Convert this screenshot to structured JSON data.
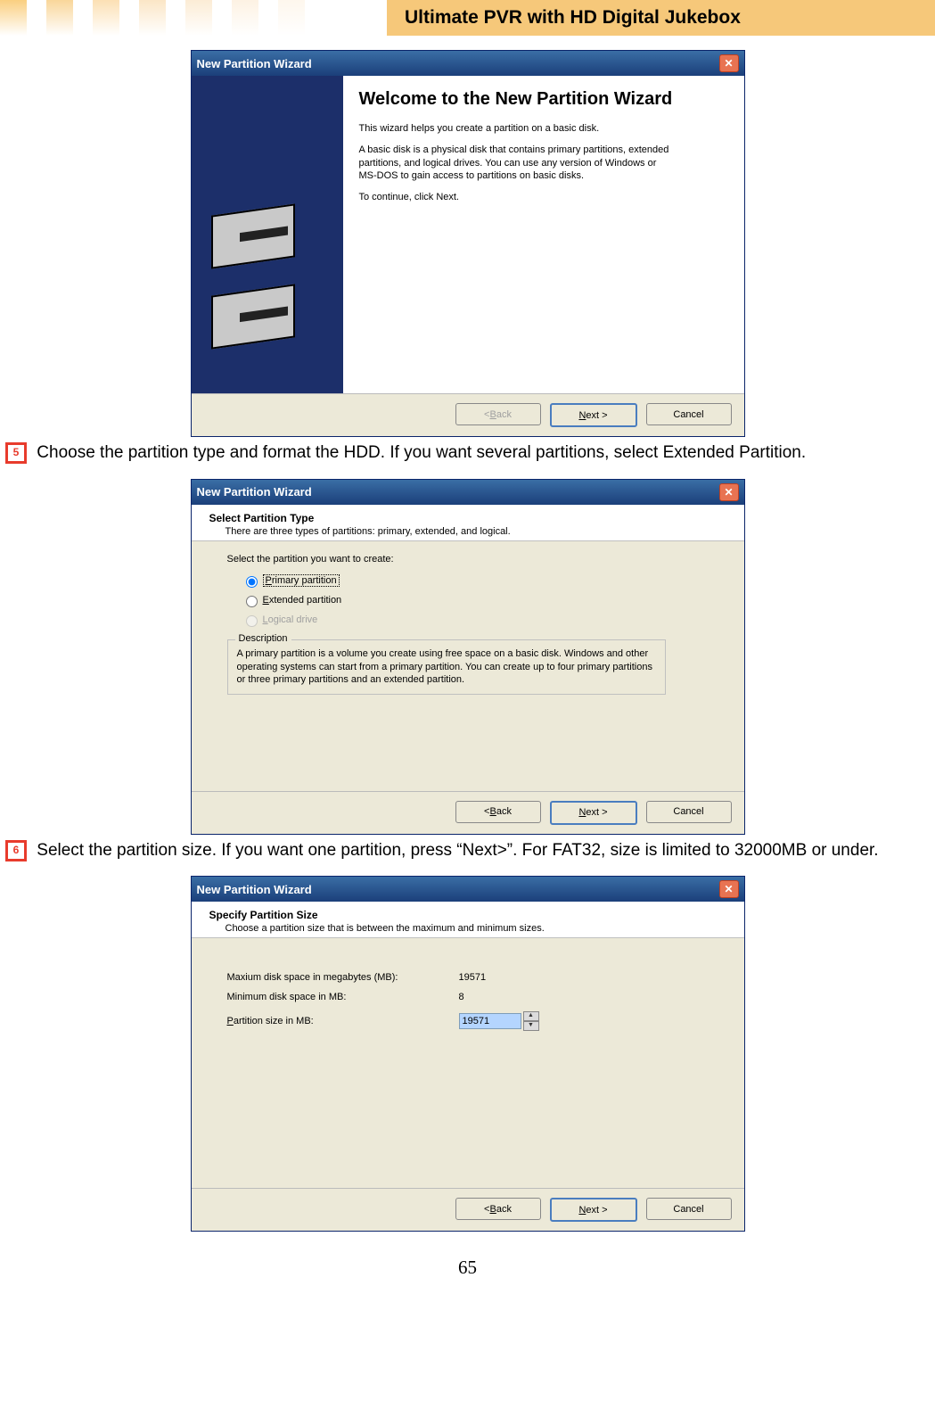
{
  "header": {
    "title": "Ultimate PVR with HD Digital Jukebox"
  },
  "steps": {
    "step5": {
      "num": "5",
      "text": "Choose the partition type and format the HDD. If you want several partitions, select Extended Partition."
    },
    "step6": {
      "num": "6",
      "text": "Select the partition size. If you want one partition, press “Next>”. For FAT32, size is limited to 32000MB or under."
    }
  },
  "dialog1": {
    "title": "New Partition Wizard",
    "heading": "Welcome to the New Partition Wizard",
    "p1": "This wizard helps you create a partition on a basic disk.",
    "p2": "A basic disk is a physical disk that contains primary partitions, extended partitions, and logical drives. You can use any version of Windows or MS-DOS to gain access to partitions on basic disks.",
    "p3": "To continue, click Next.",
    "buttons": {
      "back": "< Back",
      "next": "Next >",
      "cancel": "Cancel"
    }
  },
  "dialog2": {
    "title": "New Partition Wizard",
    "header": "Select Partition Type",
    "sub": "There are three types of partitions: primary, extended, and logical.",
    "prompt": "Select the partition you want to create:",
    "opt1": "Primary partition",
    "opt2": "Extended partition",
    "opt3": "Logical drive",
    "desc_legend": "Description",
    "desc": "A primary partition is a volume you create using free space on a basic disk. Windows and other operating systems can start from a primary partition. You can create up to four primary partitions or three primary partitions and an extended partition.",
    "buttons": {
      "back": "< Back",
      "next": "Next >",
      "cancel": "Cancel"
    }
  },
  "dialog3": {
    "title": "New Partition Wizard",
    "header": "Specify Partition Size",
    "sub": "Choose a partition size that is between the maximum and minimum sizes.",
    "rows": {
      "max": {
        "label": "Maxium disk space in megabytes (MB):",
        "value": "19571"
      },
      "min": {
        "label": "Minimum disk space in MB:",
        "value": "8"
      },
      "size": {
        "label": "Partition size in MB:",
        "value": "19571"
      }
    },
    "buttons": {
      "back": "< Back",
      "next": "Next >",
      "cancel": "Cancel"
    }
  },
  "page_number": "65"
}
